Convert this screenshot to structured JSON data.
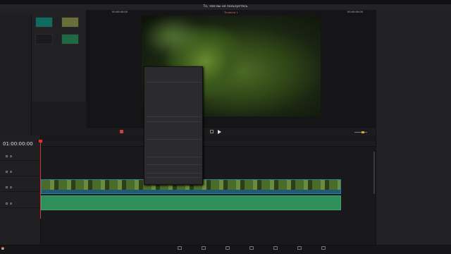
{
  "menubar": {
    "items": [
      "",
      "",
      "",
      "",
      "",
      "",
      "",
      "",
      "",
      "",
      "",
      ""
    ]
  },
  "toolbar": {
    "items": [],
    "project_title": "То, чем вы не пользуетесь",
    "right_items": []
  },
  "media_pool": {
    "label": "",
    "bins": [],
    "sections": [],
    "clips": [
      {
        "name": "",
        "color": "#0f6b5f"
      },
      {
        "name": "",
        "color": "#6a6f3a"
      },
      {
        "name": "",
        "color": "#1b1b1d"
      },
      {
        "name": "",
        "color": "#1e6a44"
      }
    ]
  },
  "viewer": {
    "timeline_name": "Timeline 1",
    "zoom": "",
    "timecode": "00:00:00:00",
    "left_time": "00:00:00:00"
  },
  "inspector": {
    "sections": [],
    "composite_rows": [],
    "transform_rows": []
  },
  "timeline": {
    "timecode": "01:00:00:00",
    "ruler_marks": [
      "",
      ""
    ],
    "tracks": [
      {
        "tag": "",
        "name": ""
      },
      {
        "tag": "",
        "name": ""
      },
      {
        "tag": "",
        "name": ""
      },
      {
        "tag": "",
        "name": ""
      }
    ],
    "video_clip_label": "",
    "audio_clip_label": ""
  },
  "context_menu": {
    "items": [
      {
        "label": "",
        "shortcut": "",
        "checked": false
      },
      {
        "label": "",
        "shortcut": "",
        "checked": false
      },
      {
        "label": "",
        "shortcut": "",
        "checked": false
      },
      {
        "label": "",
        "shortcut": "",
        "checked": false
      },
      {
        "label": "",
        "shortcut": "",
        "checked": false
      },
      {
        "label": "",
        "shortcut": "",
        "checked": false
      },
      {
        "label": "",
        "shortcut": "",
        "checked": false
      },
      {
        "label": "",
        "shortcut": "",
        "checked": false
      },
      {
        "label": "",
        "shortcut": "",
        "checked": false
      },
      {
        "label": "",
        "shortcut": "",
        "checked": false
      },
      {
        "label": "",
        "shortcut": "",
        "checked": false
      },
      {
        "label": "",
        "shortcut": "",
        "checked": false
      },
      {
        "label": "",
        "shortcut": "",
        "checked": false
      },
      {
        "label": "",
        "shortcut": "",
        "checked": false
      },
      {
        "label": "",
        "shortcut": "",
        "checked": false
      },
      {
        "label": "",
        "shortcut": "",
        "checked": false
      },
      {
        "label": "",
        "shortcut": "",
        "checked": false
      },
      {
        "label": "",
        "shortcut": "",
        "checked": false
      },
      {
        "label": "",
        "shortcut": "",
        "checked": false
      },
      {
        "label": "",
        "shortcut": "",
        "checked": false
      },
      {
        "label": "",
        "shortcut": "",
        "checked": false
      },
      {
        "label": "",
        "shortcut": "",
        "checked": false
      },
      {
        "label": "",
        "shortcut": "",
        "checked": false
      },
      {
        "label": "",
        "shortcut": "",
        "checked": false
      },
      {
        "label": "",
        "shortcut": "",
        "checked": false
      },
      {
        "label": "",
        "shortcut": "",
        "checked": false
      },
      {
        "label": "",
        "shortcut": "",
        "checked": false
      },
      {
        "label": "",
        "shortcut": "",
        "checked": false
      },
      {
        "label": "",
        "shortcut": "",
        "checked": false
      },
      {
        "label": "",
        "shortcut": "",
        "checked": false
      },
      {
        "label": "",
        "shortcut": "",
        "checked": false
      }
    ]
  },
  "pages": [
    {
      "label": "",
      "active": false
    },
    {
      "label": "",
      "active": false
    },
    {
      "label": "",
      "active": false
    },
    {
      "label": "",
      "active": false
    },
    {
      "label": "",
      "active": false
    },
    {
      "label": "",
      "active": false
    },
    {
      "label": "",
      "active": false
    }
  ],
  "app_name": "",
  "colors": {
    "video_clip": "#1f5a78",
    "audio_clip": "#2f8f5a",
    "playhead": "#e03030",
    "accent": "#e0a030"
  }
}
